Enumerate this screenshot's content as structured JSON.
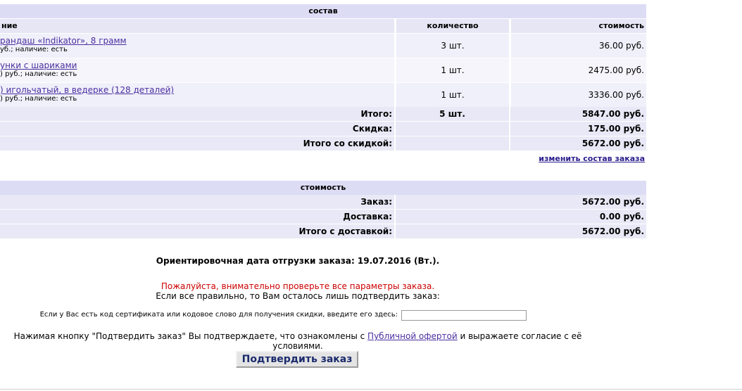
{
  "composition": {
    "header": "состав",
    "col_name": "ние",
    "col_qty": "количество",
    "col_cost": "стоимость",
    "items": [
      {
        "name": "рандаш «Indikator», 8 грамм",
        "sub": "уб.; наличие: есть",
        "qty": "3 шт.",
        "cost": "36.00 руб."
      },
      {
        "name": "унки с шариками",
        "sub": ") руб.; наличие: есть",
        "qty": "1 шт.",
        "cost": "2475.00 руб."
      },
      {
        "name": ") игольчатый, в ведерке (128 деталей)",
        "sub": ") руб.; наличие: есть",
        "qty": "1 шт.",
        "cost": "3336.00 руб."
      }
    ],
    "total_label": "Итого:",
    "total_qty": "5 шт.",
    "total_cost": "5847.00 руб.",
    "discount_label": "Скидка:",
    "discount_value": "175.00 руб.",
    "total_discount_label": "Итого со скидкой:",
    "total_discount_value": "5672.00 руб.",
    "edit_link": "изменить состав заказа"
  },
  "cost": {
    "header": "стоимость",
    "order_label": "Заказ:",
    "order_value": "5672.00 руб.",
    "delivery_label": "Доставка:",
    "delivery_value": "0.00 руб.",
    "total_label": "Итого с доставкой:",
    "total_value": "5672.00 руб."
  },
  "shipping_date": "Ориентировочная дата отгрузки заказа: 19.07.2016 (Вт.).",
  "warning": "Пожалуйста, внимательно проверьте все параметры заказа.",
  "confirm_hint": "Если все правильно, то Вам осталось лишь подтвердить заказ:",
  "promo_label": "Если у Вас есть код сертификата или кодовое слово для получения скидки, введите его здесь:",
  "promo_value": "",
  "offer_text_before": "Нажимая кнопку \"Подтвердить заказ\" Вы подтверждаете, что ознакомлены с",
  "offer_link": "Публичной офертой",
  "offer_text_after": "и выражаете согласие с её условиями.",
  "confirm_button": "Подтвердить заказ",
  "colors": {
    "header_bg": "#dcdcf5",
    "row_bg": "#f0f0fa",
    "warning": "#cc0000",
    "link": "#4b2fa0"
  }
}
